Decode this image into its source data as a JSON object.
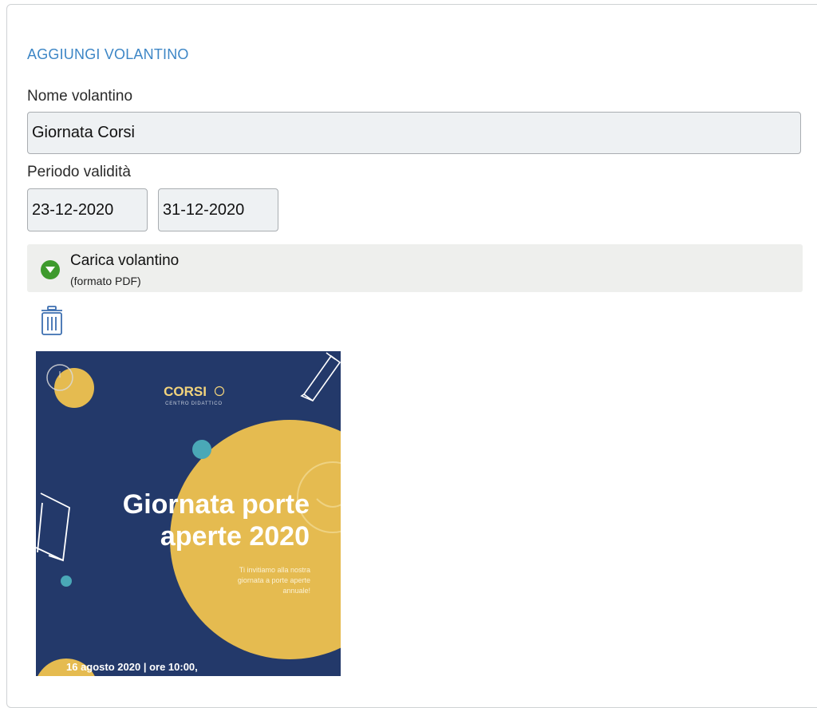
{
  "form": {
    "section_title": "AGGIUNGI VOLANTINO",
    "name_label": "Nome volantino",
    "name_value": "Giornata Corsi",
    "period_label": "Periodo validità",
    "date_from": "23-12-2020",
    "date_to": "31-12-2020",
    "upload_title": "Carica volantino",
    "upload_subtitle": "(formato PDF)"
  },
  "icons": {
    "upload": "chevron-down-circle-icon",
    "delete": "trash-icon"
  },
  "flyer": {
    "brand": "CORSI",
    "brand_sub": "CENTRO DIDATTICO",
    "title_line1": "Giornata porte",
    "title_line2": "aperte 2020",
    "body_line1": "Ti invitiamo alla nostra",
    "body_line2": "giornata a porte aperte",
    "body_line3": "annuale!",
    "date_line": "16 agosto 2020 | ore 10:00,"
  },
  "colors": {
    "accent": "#3d86c6",
    "success": "#3e9a2d",
    "flyer_bg": "#23396a",
    "flyer_yellow": "#e5bb50",
    "flyer_teal": "#4aa8b7"
  }
}
